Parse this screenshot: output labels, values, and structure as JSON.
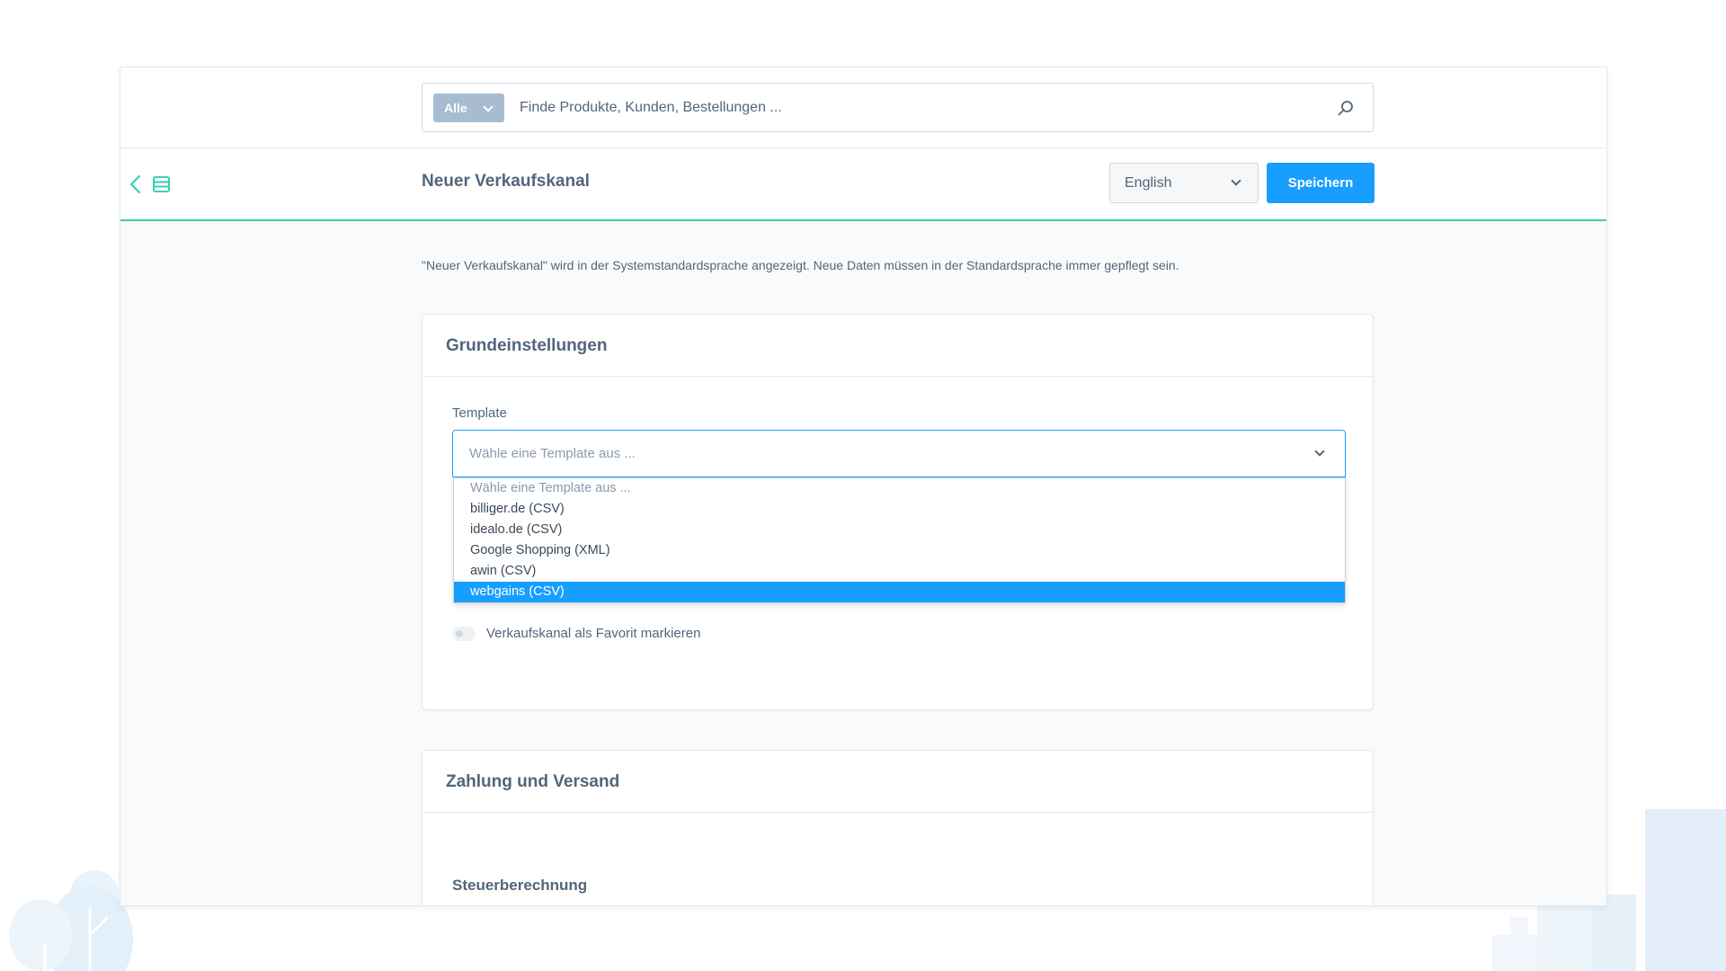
{
  "search": {
    "type_label": "Alle",
    "placeholder": "Finde Produkte, Kunden, Bestellungen ..."
  },
  "header": {
    "title": "Neuer Verkaufskanal",
    "language": "English",
    "save_label": "Speichern"
  },
  "info_text": "\"Neuer Verkaufskanal\" wird in der Systemstandardsprache angezeigt. Neue Daten müssen in der Standardsprache immer gepflegt sein.",
  "basic_settings": {
    "title": "Grundeinstellungen",
    "template_label": "Template",
    "template_placeholder": "Wähle eine Template aus ...",
    "template_options": [
      "Wähle eine Template aus ...",
      "billiger.de (CSV)",
      "idealo.de (CSV)",
      "Google Shopping (XML)",
      "awin (CSV)",
      "webgains (CSV)"
    ],
    "selected_option_index": 5,
    "favorite_toggle_label": "Verkaufskanal als Favorit markieren",
    "favorite_toggle_on": false
  },
  "payment_shipping": {
    "title": "Zahlung und Versand",
    "subtitle": "Steuerberechnung"
  },
  "colors": {
    "accent": "#189eff",
    "header_underline": "#37d0b0",
    "text": "#52667a"
  },
  "icons": {
    "back": "chevron-left-icon",
    "list": "list-icon",
    "search": "magnifier-icon"
  }
}
